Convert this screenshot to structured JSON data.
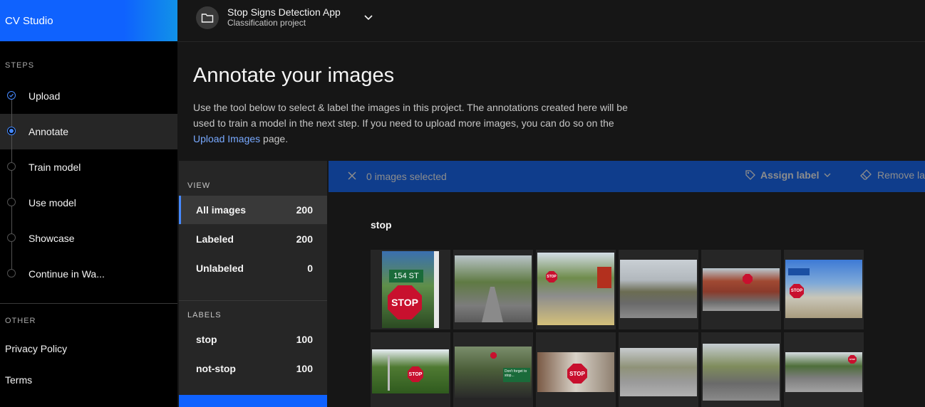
{
  "app": {
    "brand": "CV Studio"
  },
  "sidebar": {
    "steps_label": "STEPS",
    "steps": [
      {
        "label": "Upload",
        "state": "complete"
      },
      {
        "label": "Annotate",
        "state": "current"
      },
      {
        "label": "Train model",
        "state": "incomplete"
      },
      {
        "label": "Use model",
        "state": "incomplete"
      },
      {
        "label": "Showcase",
        "state": "incomplete"
      },
      {
        "label": "Continue in Wa...",
        "state": "incomplete"
      }
    ],
    "other_label": "OTHER",
    "links": [
      {
        "label": "Privacy Policy"
      },
      {
        "label": "Terms"
      }
    ]
  },
  "header": {
    "project_name": "Stop Signs Detection App",
    "project_type": "Classification project"
  },
  "intro": {
    "title": "Annotate your images",
    "desc_before": "Use the tool below to select & label the images in this project. The annotations created here will be used to train a model in the next step. If you need to upload more images, you can do so on the ",
    "desc_link": "Upload Images",
    "desc_after": " page."
  },
  "view_panel": {
    "view_label": "VIEW",
    "filters": [
      {
        "label": "All images",
        "count": "200",
        "selected": true
      },
      {
        "label": "Labeled",
        "count": "200",
        "selected": false
      },
      {
        "label": "Unlabeled",
        "count": "0",
        "selected": false
      }
    ],
    "labels_label": "LABELS",
    "labels": [
      {
        "label": "stop",
        "count": "100"
      },
      {
        "label": "not-stop",
        "count": "100"
      }
    ]
  },
  "toolbar": {
    "selection_text": "0 images selected",
    "assign_label": "Assign label",
    "remove_label": "Remove la"
  },
  "gallery": {
    "group_title": "stop",
    "images_row1": [
      {
        "text": "STOP",
        "sign_text_top": "154 ST"
      },
      {
        "text": ""
      },
      {
        "text": "STOP"
      },
      {
        "text": ""
      },
      {
        "text": ""
      },
      {
        "text": "STOP"
      }
    ],
    "images_row2": [
      {
        "text": "STOP"
      },
      {
        "text": "Don't forget to stop..."
      },
      {
        "text": "STOP"
      },
      {
        "text": ""
      },
      {
        "text": ""
      },
      {
        "text": "STOP"
      }
    ]
  },
  "colors": {
    "brand_blue": "#0f62fe",
    "toolbar_blue": "#0f3d8c",
    "link_blue": "#78a9ff",
    "stop_red": "#c8102e"
  }
}
